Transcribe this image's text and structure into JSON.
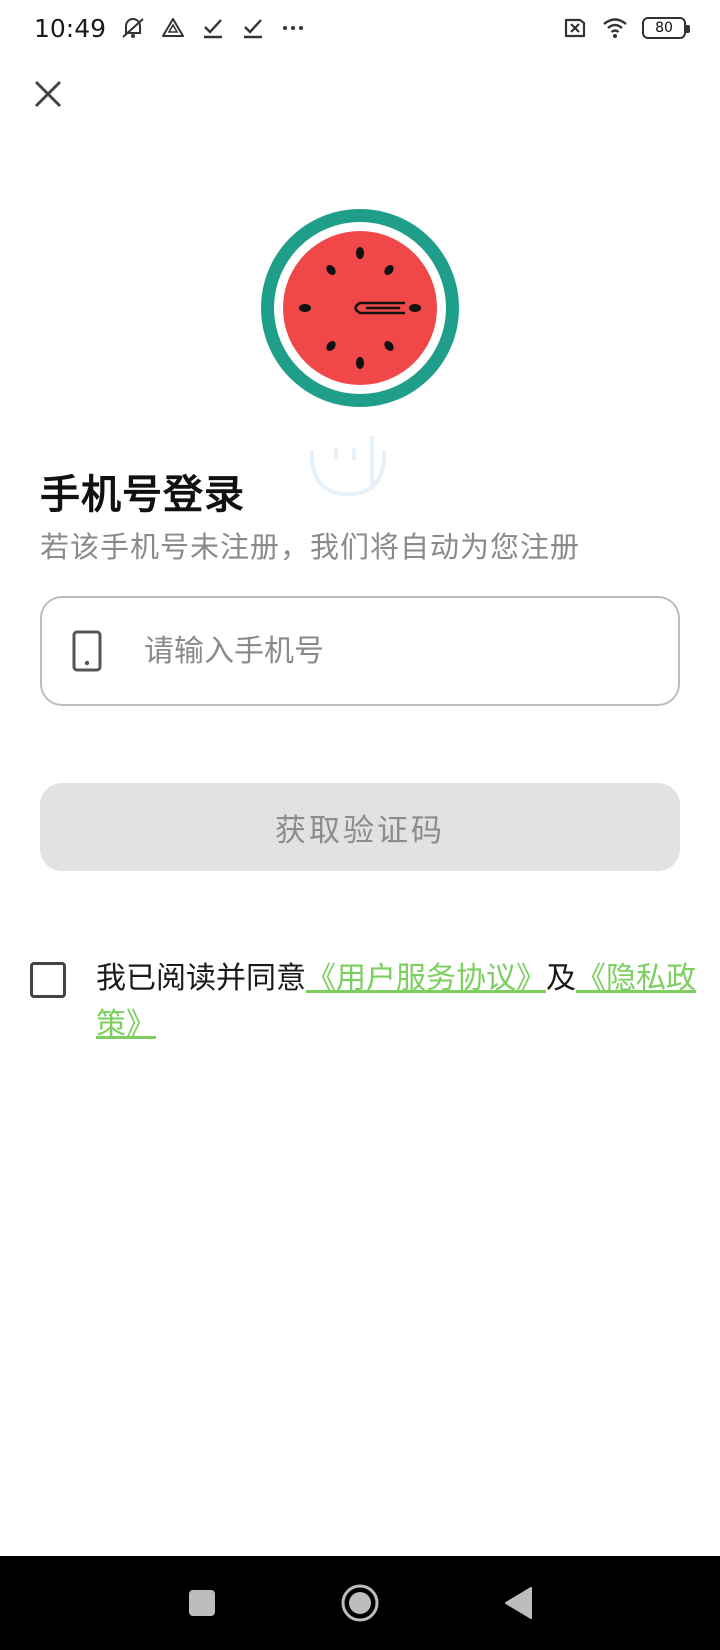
{
  "status_bar": {
    "time": "10:49",
    "battery": "80",
    "left_icons": [
      "mute-icon",
      "alert-triangle-icon",
      "check-icon",
      "check-icon",
      "more-dots-icon"
    ],
    "right_icons": [
      "no-sim-icon",
      "wifi-icon",
      "battery-icon"
    ]
  },
  "header": {
    "close_icon": "close-icon"
  },
  "login": {
    "title": "手机号登录",
    "subtitle": "若该手机号未注册，我们将自动为您注册",
    "phone_placeholder": "请输入手机号",
    "phone_value": "",
    "get_code_label": "获取验证码"
  },
  "agreement": {
    "prefix": "我已阅读并同意",
    "terms_link": "《用户服务协议》",
    "conjunction": "及",
    "privacy_link": "《隐私政策》",
    "checked": false
  },
  "colors": {
    "accent_link": "#7ccf5f",
    "logo_ring": "#1f9e8a",
    "logo_fill": "#f04848",
    "button_disabled_bg": "#e2e2e2"
  }
}
